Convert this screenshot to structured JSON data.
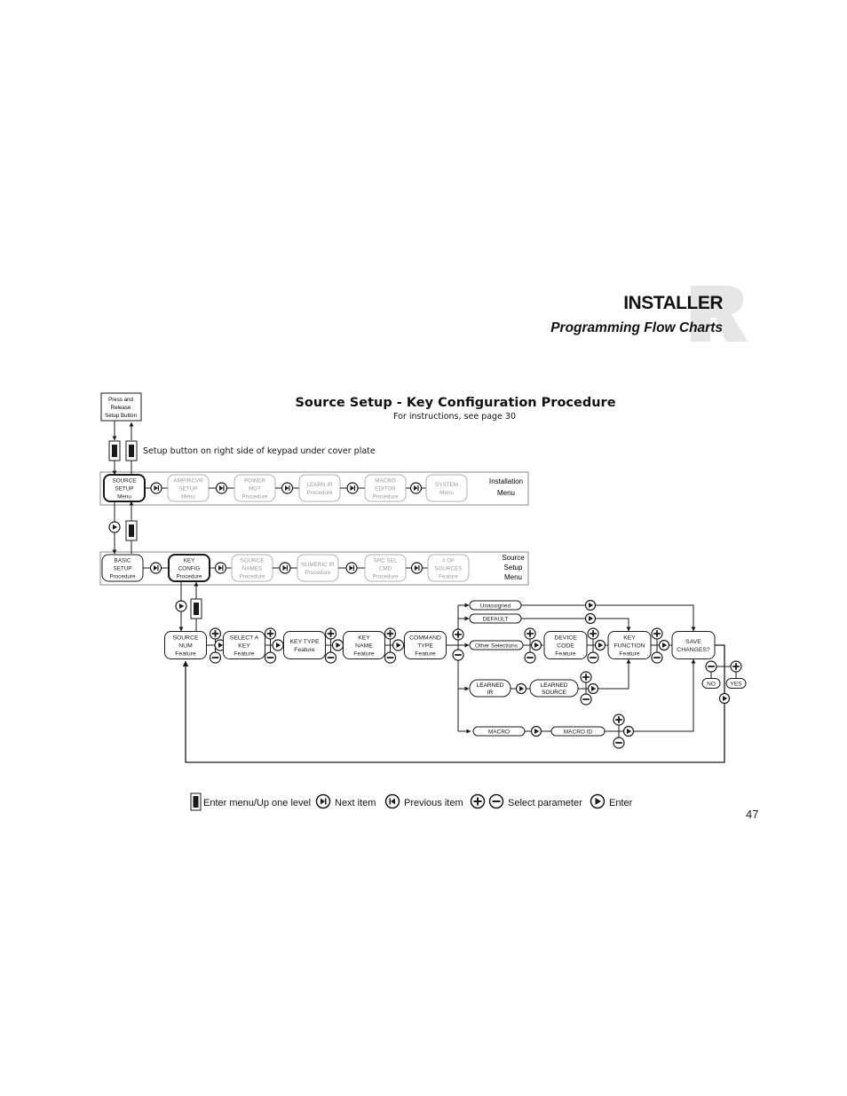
{
  "header": {
    "title": "INSTALLER",
    "subtitle": "Programming Flow Charts",
    "logo": "r-logo-watermark"
  },
  "diagram": {
    "title": "Source Setup - Key Configuration Procedure",
    "subtitle": "For instructions, see page 30",
    "start_box": [
      "Press and",
      "Release",
      "Setup Button"
    ],
    "setup_note": "Setup button on right side of keypad under cover plate",
    "installation_menu": {
      "label": [
        "Installation",
        "Menu"
      ],
      "items": [
        {
          "lines": [
            "SOURCE",
            "SETUP",
            "Menu"
          ],
          "active": true
        },
        {
          "lines": [
            "AMP/RCVR",
            "SETUP",
            "Menu"
          ],
          "active": false
        },
        {
          "lines": [
            "POWER",
            "MGT",
            "Procedure"
          ],
          "active": false
        },
        {
          "lines": [
            "LEARN IR",
            "Procedure"
          ],
          "active": false
        },
        {
          "lines": [
            "MACRO",
            "EDITOR",
            "Procedure"
          ],
          "active": false
        },
        {
          "lines": [
            "SYSTEM",
            "Menu"
          ],
          "active": false
        }
      ]
    },
    "source_setup_menu": {
      "label": [
        "Source",
        "Setup",
        "Menu"
      ],
      "items": [
        {
          "lines": [
            "BASIC",
            "SETUP",
            "Procedure"
          ],
          "active": true
        },
        {
          "lines": [
            "KEY",
            "CONFIG",
            "Procedure"
          ],
          "active": true,
          "selected": true
        },
        {
          "lines": [
            "SOURCE",
            "NAMES",
            "Procedure"
          ],
          "active": false
        },
        {
          "lines": [
            "NUMERIC IR",
            "Procedure"
          ],
          "active": false
        },
        {
          "lines": [
            "SRC SEL",
            "CMD",
            "Procedure"
          ],
          "active": false
        },
        {
          "lines": [
            "# OF",
            "SOURCES",
            "Feature"
          ],
          "active": false
        }
      ]
    },
    "feature_chain": [
      {
        "lines": [
          "SOURCE",
          "NUM",
          "Feature"
        ]
      },
      {
        "lines": [
          "SELECT A",
          "KEY",
          "Feature"
        ]
      },
      {
        "lines": [
          "KEY TYPE",
          "Feature"
        ]
      },
      {
        "lines": [
          "KEY",
          "NAME",
          "Feature"
        ]
      },
      {
        "lines": [
          "COMMAND",
          "TYPE",
          "Feature"
        ]
      }
    ],
    "command_options": {
      "unassigned": "Unassigned",
      "default": "DEFAULT",
      "other": "Other Selections",
      "learned_ir": [
        "LEARNED",
        "IR"
      ],
      "learned_source": [
        "LEARNED",
        "SOURCE"
      ],
      "macro": "MACRO",
      "macro_id": "MACRO ID"
    },
    "device_code": [
      "DEVICE",
      "CODE",
      "Feature"
    ],
    "key_function": [
      "KEY",
      "FUNCTION",
      "Feature"
    ],
    "save_changes": [
      "SAVE",
      "CHANGES?"
    ],
    "no": "NO",
    "yes": "YES"
  },
  "legend": [
    {
      "icon": "setup-button-icon",
      "label": "Enter menu/Up one level"
    },
    {
      "icon": "next-item-icon",
      "label": "Next item"
    },
    {
      "icon": "previous-item-icon",
      "label": "Previous item"
    },
    {
      "icon": "plus-minus-icon",
      "label": "Select parameter"
    },
    {
      "icon": "enter-icon",
      "label": "Enter"
    }
  ],
  "page_number": "47",
  "colors": {
    "ink": "#1a1a1a",
    "inactive": "#9a9a9a",
    "menu_border": "#8a8a8a",
    "logo": "#e6e6e6"
  }
}
